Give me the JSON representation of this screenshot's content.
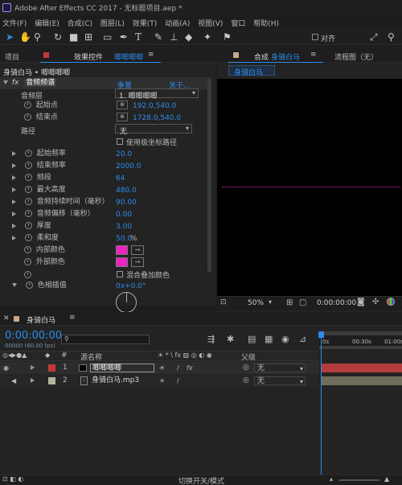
{
  "window": {
    "title": "Adobe After Effects CC 2017 - 无标题项目.aep *"
  },
  "menu": [
    "文件(F)",
    "编辑(E)",
    "合成(C)",
    "图层(L)",
    "效果(T)",
    "动画(A)",
    "视图(V)",
    "窗口",
    "帮助(H)"
  ],
  "toolbar": {
    "snap_label": "对齐"
  },
  "left_panel": {
    "tab_project": "项目",
    "tab_effects": "效果控件",
    "tab_effects_layer": "唧唧唧唧",
    "breadcrumb": "身骑白马 • 唧唧唧唧",
    "effect_name": "音频频谱",
    "reset": "重置",
    "about": "关于...",
    "audio_layer_label": "音频层",
    "audio_layer_value": "1. 唧唧唧唧",
    "start_point_label": "起始点",
    "start_point_value": "192.0,540.0",
    "end_point_label": "结束点",
    "end_point_value": "1728.0,540.0",
    "path_label": "路径",
    "path_value": "无",
    "polar_label": "使用极坐标路径",
    "params": [
      {
        "label": "起始频率",
        "value": "20.0"
      },
      {
        "label": "结束频率",
        "value": "2000.0"
      },
      {
        "label": "频段",
        "value": "64"
      },
      {
        "label": "最大高度",
        "value": "480.0"
      },
      {
        "label": "音频持续时间（毫秒）",
        "value": "90.00"
      },
      {
        "label": "音频偏移（毫秒）",
        "value": "0.00"
      },
      {
        "label": "厚度",
        "value": "3.00"
      }
    ],
    "softness_label": "柔和度",
    "softness_value": "50.0",
    "softness_unit": "%",
    "inner_color_label": "内部颜色",
    "outer_color_label": "外部颜色",
    "blend_label": "混合叠加颜色",
    "hue_label": "色相插值",
    "hue_value": "0x+0.0°",
    "colors": {
      "inner": "#ee22c4",
      "outer": "#ee22c4"
    }
  },
  "comp_panel": {
    "tab_comp_prefix": "合成",
    "tab_comp_name": "身骑白马",
    "tab_flow": "流程图（无）",
    "subtab": "身骑白马",
    "zoom": "50%",
    "timecode": "0:00:00:00"
  },
  "timeline": {
    "tab": "身骑白马",
    "timecode": "0:00:00:00",
    "fps": "00000 (60.00 fps)",
    "search_placeholder": "",
    "col_num": "#",
    "col_name": "源名称",
    "col_parent": "父级",
    "ruler": [
      "0s",
      "00:30s",
      "01:00s"
    ],
    "layers": [
      {
        "num": "1",
        "name": "唧唧唧唧",
        "parent": "无",
        "label_color": "#c03a3a"
      },
      {
        "num": "2",
        "name": "身骑白马.mp3",
        "parent": "无",
        "label_color": "#b4b49a"
      }
    ],
    "bottom_label": "切换开关/模式"
  }
}
